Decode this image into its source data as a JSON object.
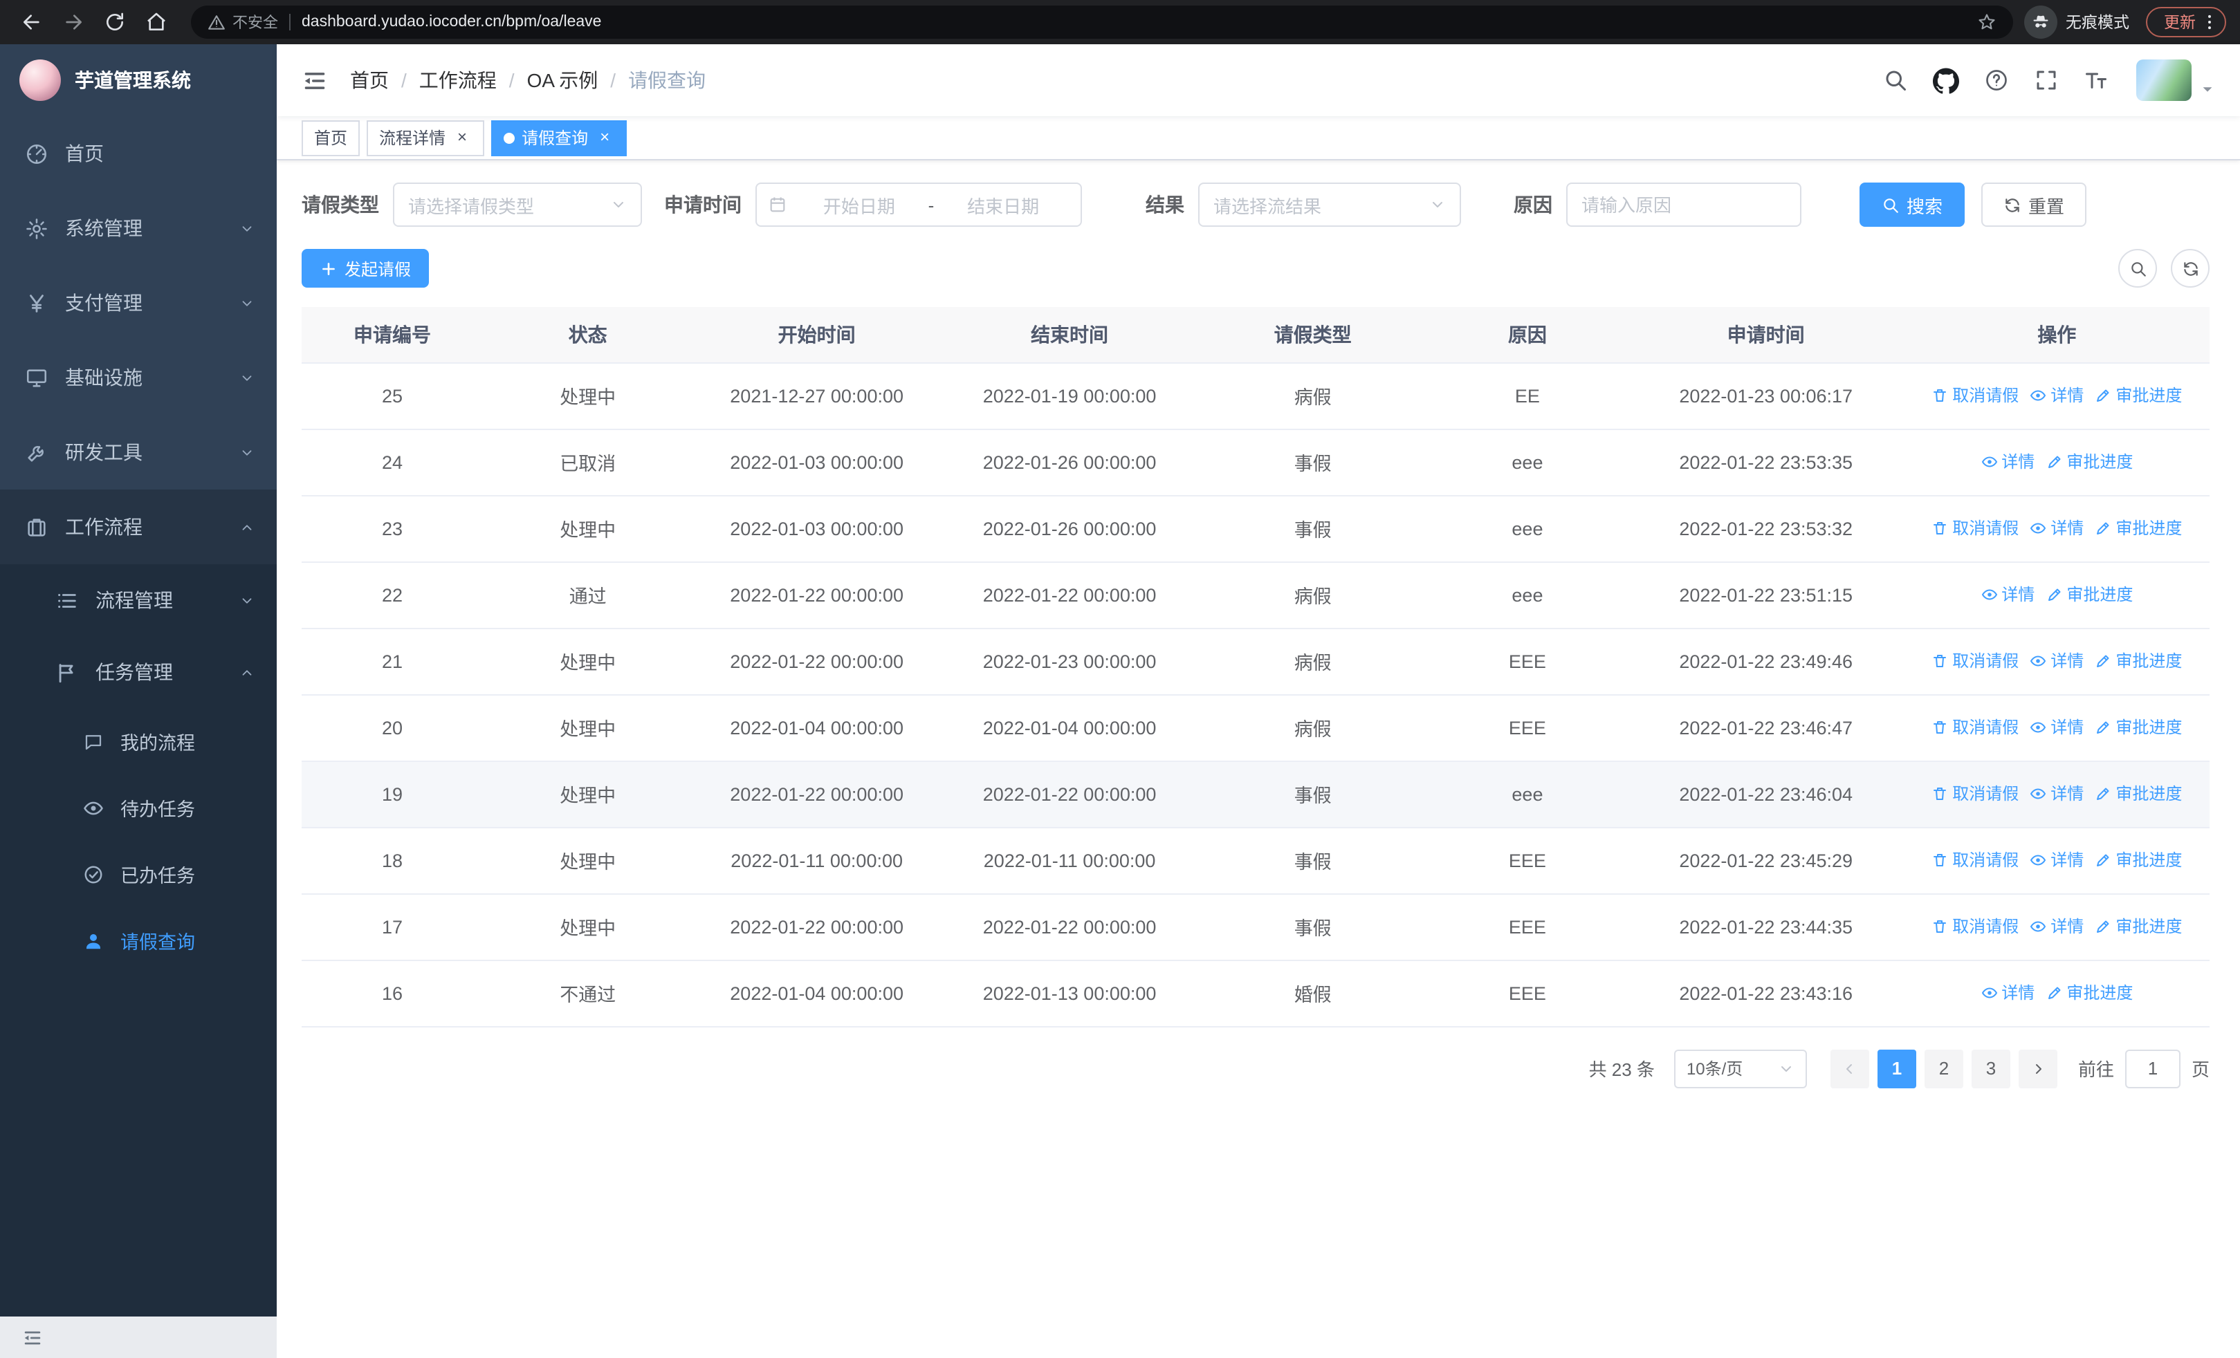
{
  "browser": {
    "security_warning": "不安全",
    "url": "dashboard.yudao.iocoder.cn/bpm/oa/leave",
    "incognito_label": "无痕模式",
    "update_label": "更新"
  },
  "sidebar": {
    "logo_title": "芋道管理系统",
    "menu": [
      {
        "key": "home",
        "label": "首页",
        "icon": "dashboard",
        "level": 0
      },
      {
        "key": "system",
        "label": "系统管理",
        "icon": "gear",
        "level": 0,
        "chevron": "down"
      },
      {
        "key": "payment",
        "label": "支付管理",
        "icon": "yen",
        "level": 0,
        "chevron": "down"
      },
      {
        "key": "infrastructure",
        "label": "基础设施",
        "icon": "infra",
        "level": 0,
        "chevron": "down"
      },
      {
        "key": "devtools",
        "label": "研发工具",
        "icon": "tools",
        "level": 0,
        "chevron": "down"
      },
      {
        "key": "workflow",
        "label": "工作流程",
        "icon": "briefcase",
        "level": 0,
        "chevron": "up",
        "open": true
      },
      {
        "key": "process-management",
        "label": "流程管理",
        "icon": "list",
        "level": 1,
        "chevron": "down"
      },
      {
        "key": "task-management",
        "label": "任务管理",
        "icon": "flag",
        "level": 1,
        "chevron": "up",
        "open": true
      },
      {
        "key": "my-process",
        "label": "我的流程",
        "icon": "chat",
        "level": 2
      },
      {
        "key": "todo-tasks",
        "label": "待办任务",
        "icon": "eye",
        "level": 2
      },
      {
        "key": "done-tasks",
        "label": "已办任务",
        "icon": "check",
        "level": 2
      },
      {
        "key": "leave-query",
        "label": "请假查询",
        "icon": "user",
        "level": 2,
        "active": true
      }
    ]
  },
  "header": {
    "breadcrumb": [
      "首页",
      "工作流程",
      "OA 示例",
      "请假查询"
    ],
    "tools": [
      {
        "name": "search",
        "icon": "search"
      },
      {
        "name": "github",
        "icon": "github"
      },
      {
        "name": "help",
        "icon": "question"
      },
      {
        "name": "fullscreen",
        "icon": "fullscreen"
      },
      {
        "name": "font-size",
        "icon": "fontsize"
      }
    ]
  },
  "tabs": [
    {
      "key": "home",
      "label": "首页",
      "active": false,
      "closable": false
    },
    {
      "key": "process-detail",
      "label": "流程详情",
      "active": false,
      "closable": true
    },
    {
      "key": "leave-query",
      "label": "请假查询",
      "active": true,
      "closable": true
    }
  ],
  "filters": {
    "leave_type": {
      "label": "请假类型",
      "placeholder": "请选择请假类型"
    },
    "apply_time": {
      "label": "申请时间",
      "start_placeholder": "开始日期",
      "separator": "-",
      "end_placeholder": "结束日期"
    },
    "result": {
      "label": "结果",
      "placeholder": "请选择流结果"
    },
    "reason": {
      "label": "原因",
      "placeholder": "请输入原因"
    },
    "search_label": "搜索",
    "reset_label": "重置"
  },
  "toolbar": {
    "create_label": "发起请假"
  },
  "table": {
    "columns": [
      "申请编号",
      "状态",
      "开始时间",
      "结束时间",
      "请假类型",
      "原因",
      "申请时间",
      "操作"
    ],
    "action_defs": {
      "cancel": {
        "label": "取消请假",
        "icon": "trash",
        "name": "cancel-leave"
      },
      "detail": {
        "label": "详情",
        "icon": "eye",
        "name": "detail"
      },
      "progress": {
        "label": "审批进度",
        "icon": "edit",
        "name": "approval-progress"
      }
    },
    "rows": [
      {
        "id": "25",
        "status": "处理中",
        "start": "2021-12-27 00:00:00",
        "end": "2022-01-19 00:00:00",
        "type": "病假",
        "reason": "EE",
        "apply_time": "2022-01-23 00:06:17",
        "actions": [
          "cancel",
          "detail",
          "progress"
        ]
      },
      {
        "id": "24",
        "status": "已取消",
        "start": "2022-01-03 00:00:00",
        "end": "2022-01-26 00:00:00",
        "type": "事假",
        "reason": "eee",
        "apply_time": "2022-01-22 23:53:35",
        "actions": [
          "detail",
          "progress"
        ]
      },
      {
        "id": "23",
        "status": "处理中",
        "start": "2022-01-03 00:00:00",
        "end": "2022-01-26 00:00:00",
        "type": "事假",
        "reason": "eee",
        "apply_time": "2022-01-22 23:53:32",
        "actions": [
          "cancel",
          "detail",
          "progress"
        ]
      },
      {
        "id": "22",
        "status": "通过",
        "start": "2022-01-22 00:00:00",
        "end": "2022-01-22 00:00:00",
        "type": "病假",
        "reason": "eee",
        "apply_time": "2022-01-22 23:51:15",
        "actions": [
          "detail",
          "progress"
        ]
      },
      {
        "id": "21",
        "status": "处理中",
        "start": "2022-01-22 00:00:00",
        "end": "2022-01-23 00:00:00",
        "type": "病假",
        "reason": "EEE",
        "apply_time": "2022-01-22 23:49:46",
        "actions": [
          "cancel",
          "detail",
          "progress"
        ]
      },
      {
        "id": "20",
        "status": "处理中",
        "start": "2022-01-04 00:00:00",
        "end": "2022-01-04 00:00:00",
        "type": "病假",
        "reason": "EEE",
        "apply_time": "2022-01-22 23:46:47",
        "actions": [
          "cancel",
          "detail",
          "progress"
        ]
      },
      {
        "id": "19",
        "status": "处理中",
        "start": "2022-01-22 00:00:00",
        "end": "2022-01-22 00:00:00",
        "type": "事假",
        "reason": "eee",
        "apply_time": "2022-01-22 23:46:04",
        "actions": [
          "cancel",
          "detail",
          "progress"
        ],
        "highlight": true
      },
      {
        "id": "18",
        "status": "处理中",
        "start": "2022-01-11 00:00:00",
        "end": "2022-01-11 00:00:00",
        "type": "事假",
        "reason": "EEE",
        "apply_time": "2022-01-22 23:45:29",
        "actions": [
          "cancel",
          "detail",
          "progress"
        ]
      },
      {
        "id": "17",
        "status": "处理中",
        "start": "2022-01-22 00:00:00",
        "end": "2022-01-22 00:00:00",
        "type": "事假",
        "reason": "EEE",
        "apply_time": "2022-01-22 23:44:35",
        "actions": [
          "cancel",
          "detail",
          "progress"
        ]
      },
      {
        "id": "16",
        "status": "不通过",
        "start": "2022-01-04 00:00:00",
        "end": "2022-01-13 00:00:00",
        "type": "婚假",
        "reason": "EEE",
        "apply_time": "2022-01-22 23:43:16",
        "actions": [
          "detail",
          "progress"
        ]
      }
    ]
  },
  "pagination": {
    "total": "共 23 条",
    "page_size": "10条/页",
    "pages": [
      {
        "label": "1",
        "active": true
      },
      {
        "label": "2",
        "active": false
      },
      {
        "label": "3",
        "active": false
      }
    ],
    "goto_label": "前往",
    "goto_value": "1",
    "goto_suffix": "页"
  },
  "colors": {
    "primary": "#409EFF",
    "sidebar_bg": "#304156",
    "submenu_bg": "#1F2D3D",
    "active_tab_bg": "#409EFF",
    "table_header_bg": "#F8F8F9",
    "update_chip_text": "#F28B82"
  }
}
